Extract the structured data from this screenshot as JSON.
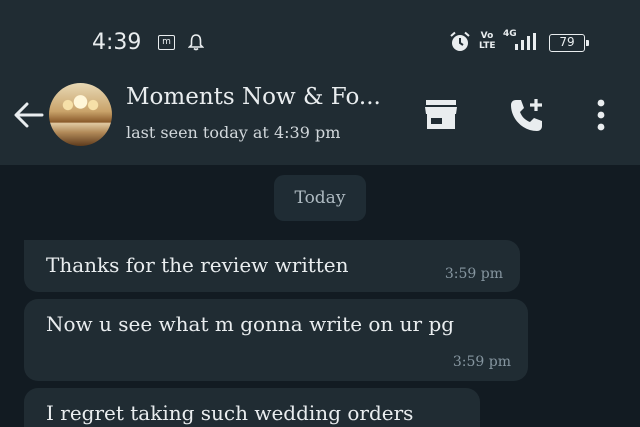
{
  "status_bar": {
    "time": "4:39",
    "m_icon_label": "m",
    "volte_line1": "Vo",
    "volte_line2": "LTE",
    "network": "4G",
    "battery": "79"
  },
  "header": {
    "contact_name": "Moments Now & Fo...",
    "last_seen": "last seen today at 4:39 pm"
  },
  "icons": {
    "back": "arrow-left-icon",
    "store": "store-icon",
    "call": "add-call-icon",
    "menu": "more-vertical-icon"
  },
  "colors": {
    "background": "#121b22",
    "header": "#202c33",
    "bubble": "#202c33",
    "text": "#e9edef",
    "time": "#8696a0"
  },
  "chat": {
    "date_chip": "Today",
    "messages": [
      {
        "text": "Thanks for the review written",
        "time": "3:59 pm"
      },
      {
        "text": "Now u see what m gonna write on ur pg",
        "time": "3:59 pm"
      },
      {
        "text": "I regret taking such wedding orders",
        "time": ""
      }
    ]
  }
}
